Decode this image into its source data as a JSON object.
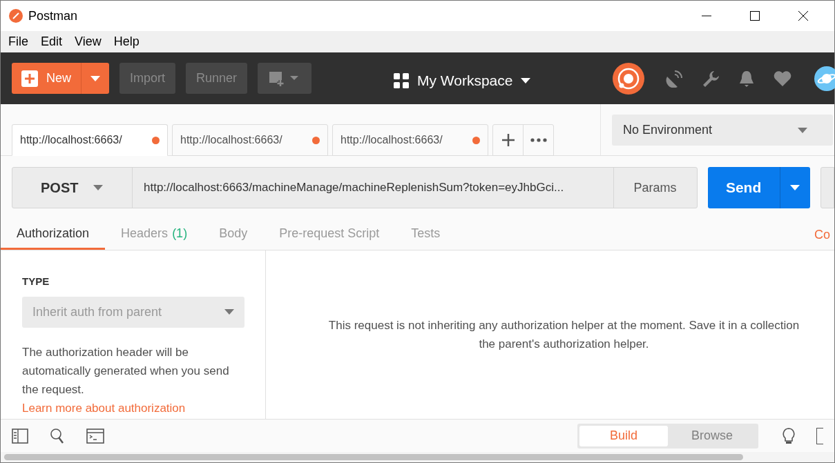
{
  "window": {
    "title": "Postman"
  },
  "menu": [
    "File",
    "Edit",
    "View",
    "Help"
  ],
  "toolbar": {
    "new_label": "New",
    "buttons": [
      "Import",
      "Runner"
    ],
    "workspace": "My Workspace"
  },
  "request_tabs": [
    {
      "label": "http://localhost:6663/",
      "selected": true,
      "unsaved": true
    },
    {
      "label": "http://localhost:6663/",
      "selected": false,
      "unsaved": true
    },
    {
      "label": "http://localhost:6663/",
      "selected": false,
      "unsaved": true
    }
  ],
  "environment": {
    "value": "No Environment"
  },
  "request": {
    "method": "POST",
    "url": "http://localhost:6663/machineManage/machineReplenishSum?token=eyJhbGci...",
    "params_label": "Params",
    "send_label": "Send"
  },
  "section_tabs": [
    {
      "label": "Authorization",
      "selected": true
    },
    {
      "label": "Headers",
      "count": "(1)",
      "selected": false
    },
    {
      "label": "Body",
      "selected": false
    },
    {
      "label": "Pre-request Script",
      "selected": false
    },
    {
      "label": "Tests",
      "selected": false
    }
  ],
  "right_link": "Co",
  "auth": {
    "type_label": "TYPE",
    "type_value": "Inherit auth from parent",
    "description": "The authorization header will be automatically generated when you send the request.",
    "link": "Learn more about authorization"
  },
  "message_lines": [
    "This request is not inheriting any authorization helper at the moment. Save it in a collection",
    "the parent's authorization helper."
  ],
  "bottom": {
    "modes": [
      {
        "label": "Build",
        "selected": true
      },
      {
        "label": "Browse",
        "selected": false
      }
    ]
  }
}
